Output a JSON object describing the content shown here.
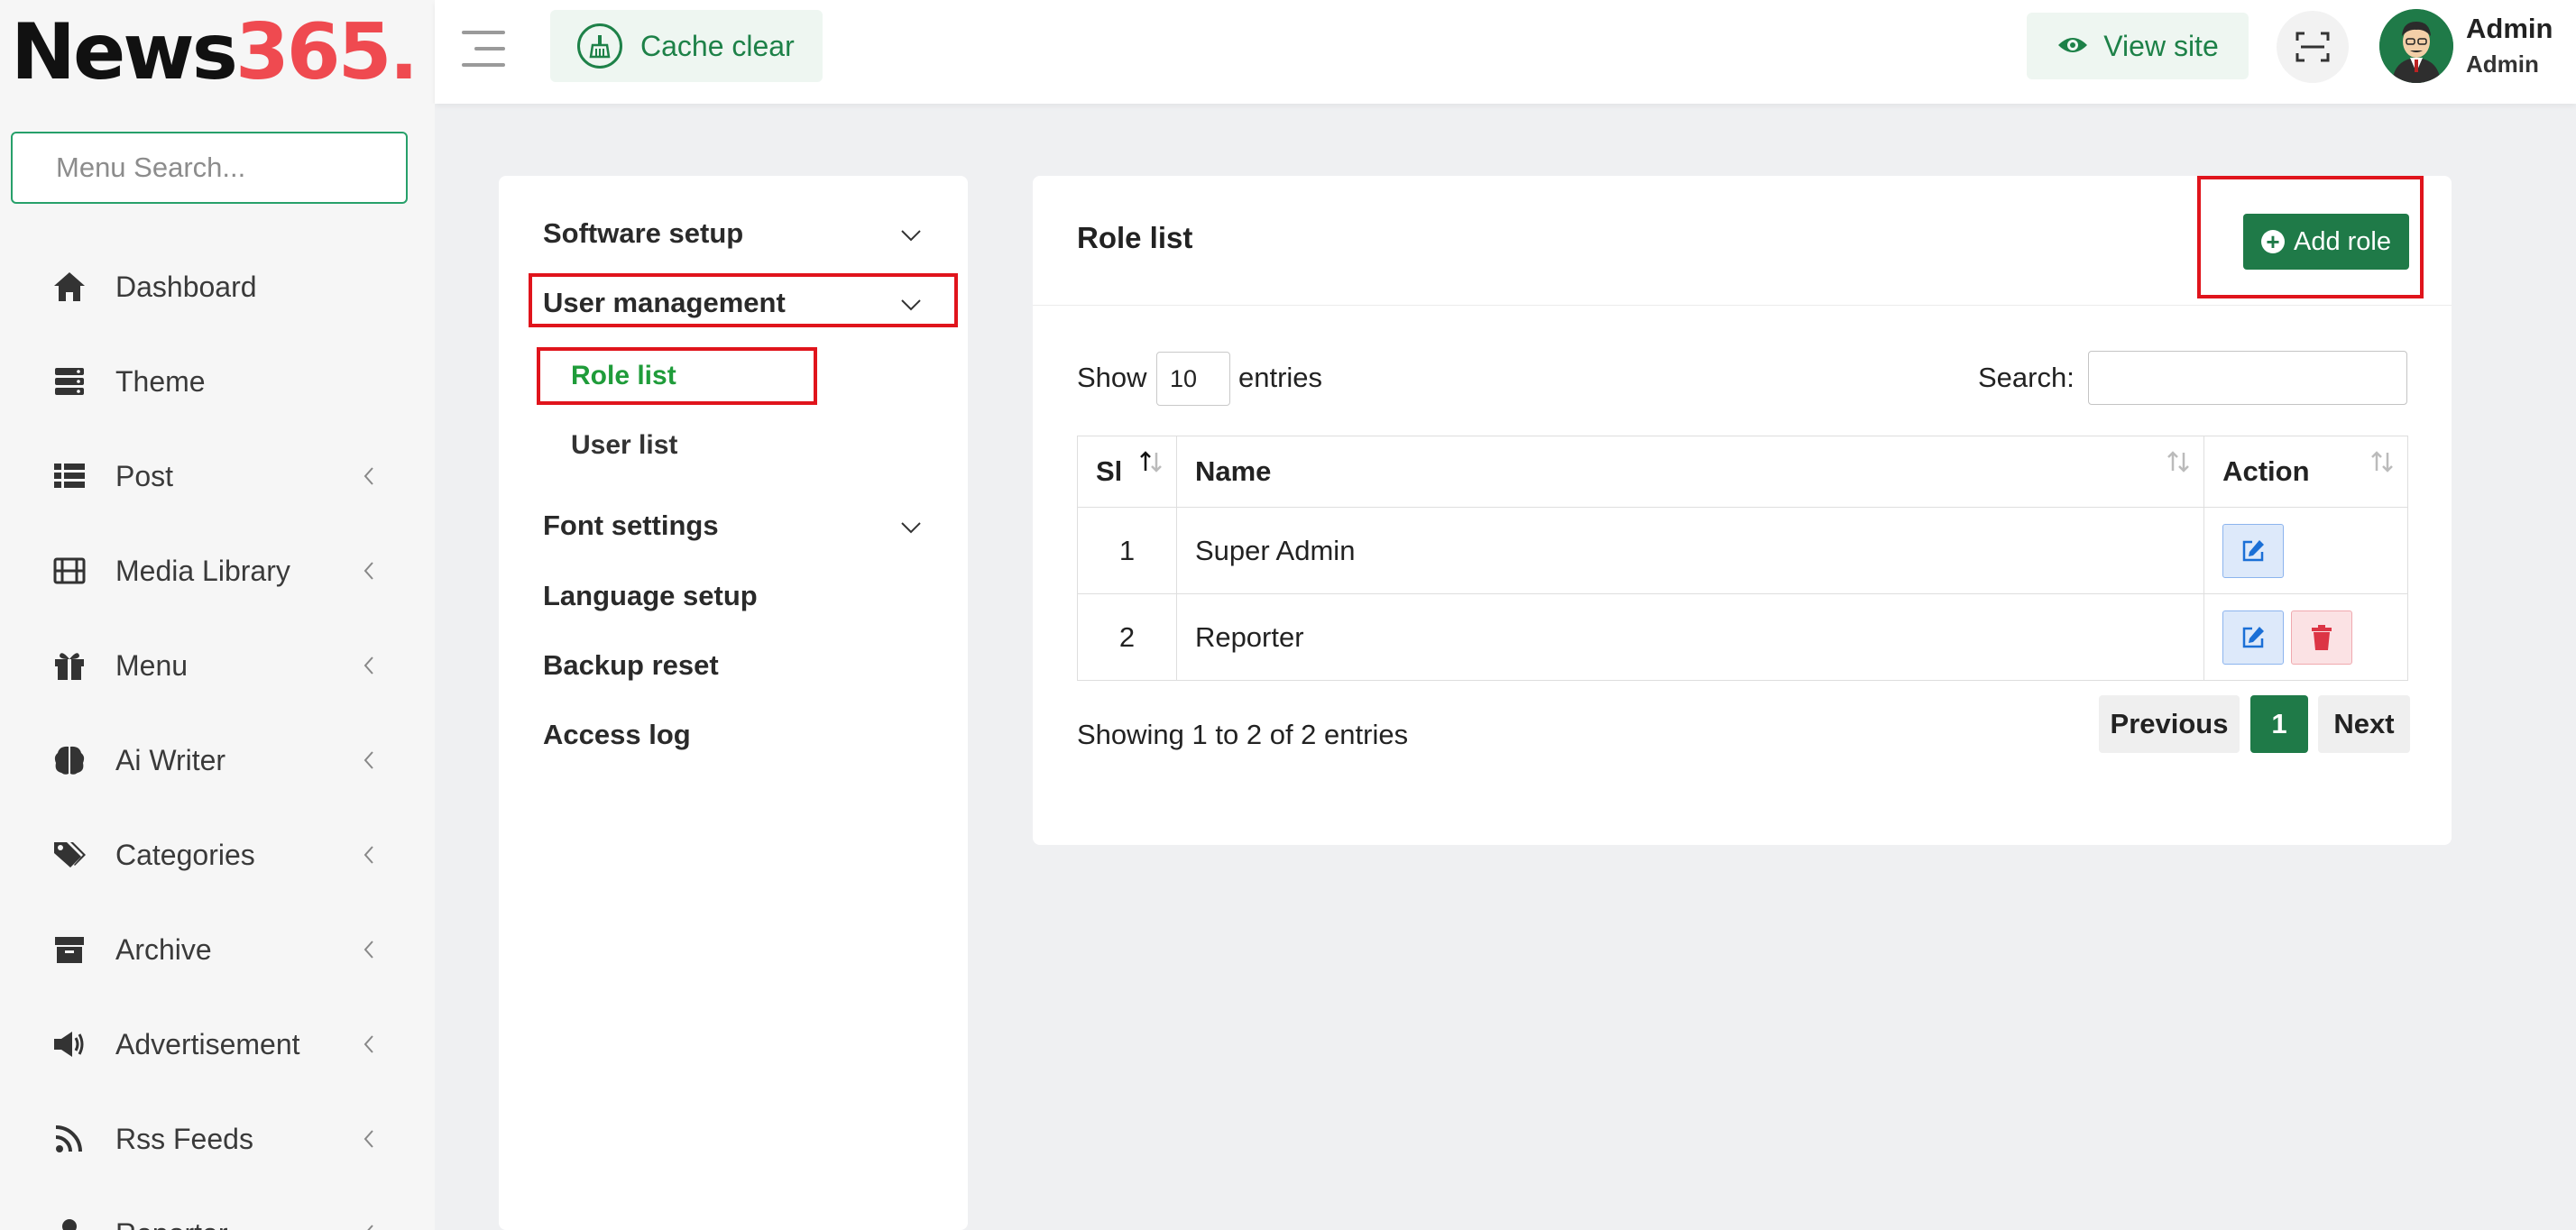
{
  "brand": {
    "part1": "News",
    "part2": "365."
  },
  "header": {
    "cache_clear": "Cache clear",
    "view_site": "View site",
    "user_name": "Admin",
    "user_role": "Admin"
  },
  "sidebar": {
    "search_placeholder": "Menu Search...",
    "items": [
      {
        "label": "Dashboard",
        "icon": "home-icon"
      },
      {
        "label": "Theme",
        "icon": "server-icon"
      },
      {
        "label": "Post",
        "icon": "list-icon"
      },
      {
        "label": "Media Library",
        "icon": "film-icon"
      },
      {
        "label": "Menu",
        "icon": "gift-icon"
      },
      {
        "label": "Ai Writer",
        "icon": "brain-icon"
      },
      {
        "label": "Categories",
        "icon": "tags-icon"
      },
      {
        "label": "Archive",
        "icon": "archive-icon"
      },
      {
        "label": "Advertisement",
        "icon": "megaphone-icon"
      },
      {
        "label": "Rss Feeds",
        "icon": "rss-icon"
      },
      {
        "label": "Reporter",
        "icon": "user-icon"
      }
    ]
  },
  "settings_menu": {
    "software_setup": "Software setup",
    "user_management": "User management",
    "role_list": "Role list",
    "user_list": "User list",
    "font_settings": "Font settings",
    "language_setup": "Language setup",
    "backup_reset": "Backup reset",
    "access_log": "Access log"
  },
  "role_card": {
    "title": "Role list",
    "add_role": "Add role",
    "show": "Show",
    "page_size": "10",
    "entries": "entries",
    "search_label": "Search:",
    "search_value": "",
    "columns": [
      "Sl",
      "Name",
      "Action"
    ],
    "rows": [
      {
        "sl": "1",
        "name": "Super Admin"
      },
      {
        "sl": "2",
        "name": "Reporter"
      }
    ],
    "info": "Showing 1 to 2 of 2 entries",
    "pagination": {
      "previous": "Previous",
      "current": "1",
      "next": "Next"
    }
  },
  "colors": {
    "brand_green": "#1f7a48",
    "logo_red": "#ef4a50",
    "active_link": "#1f9c3a",
    "highlight_red": "#e0141c"
  }
}
